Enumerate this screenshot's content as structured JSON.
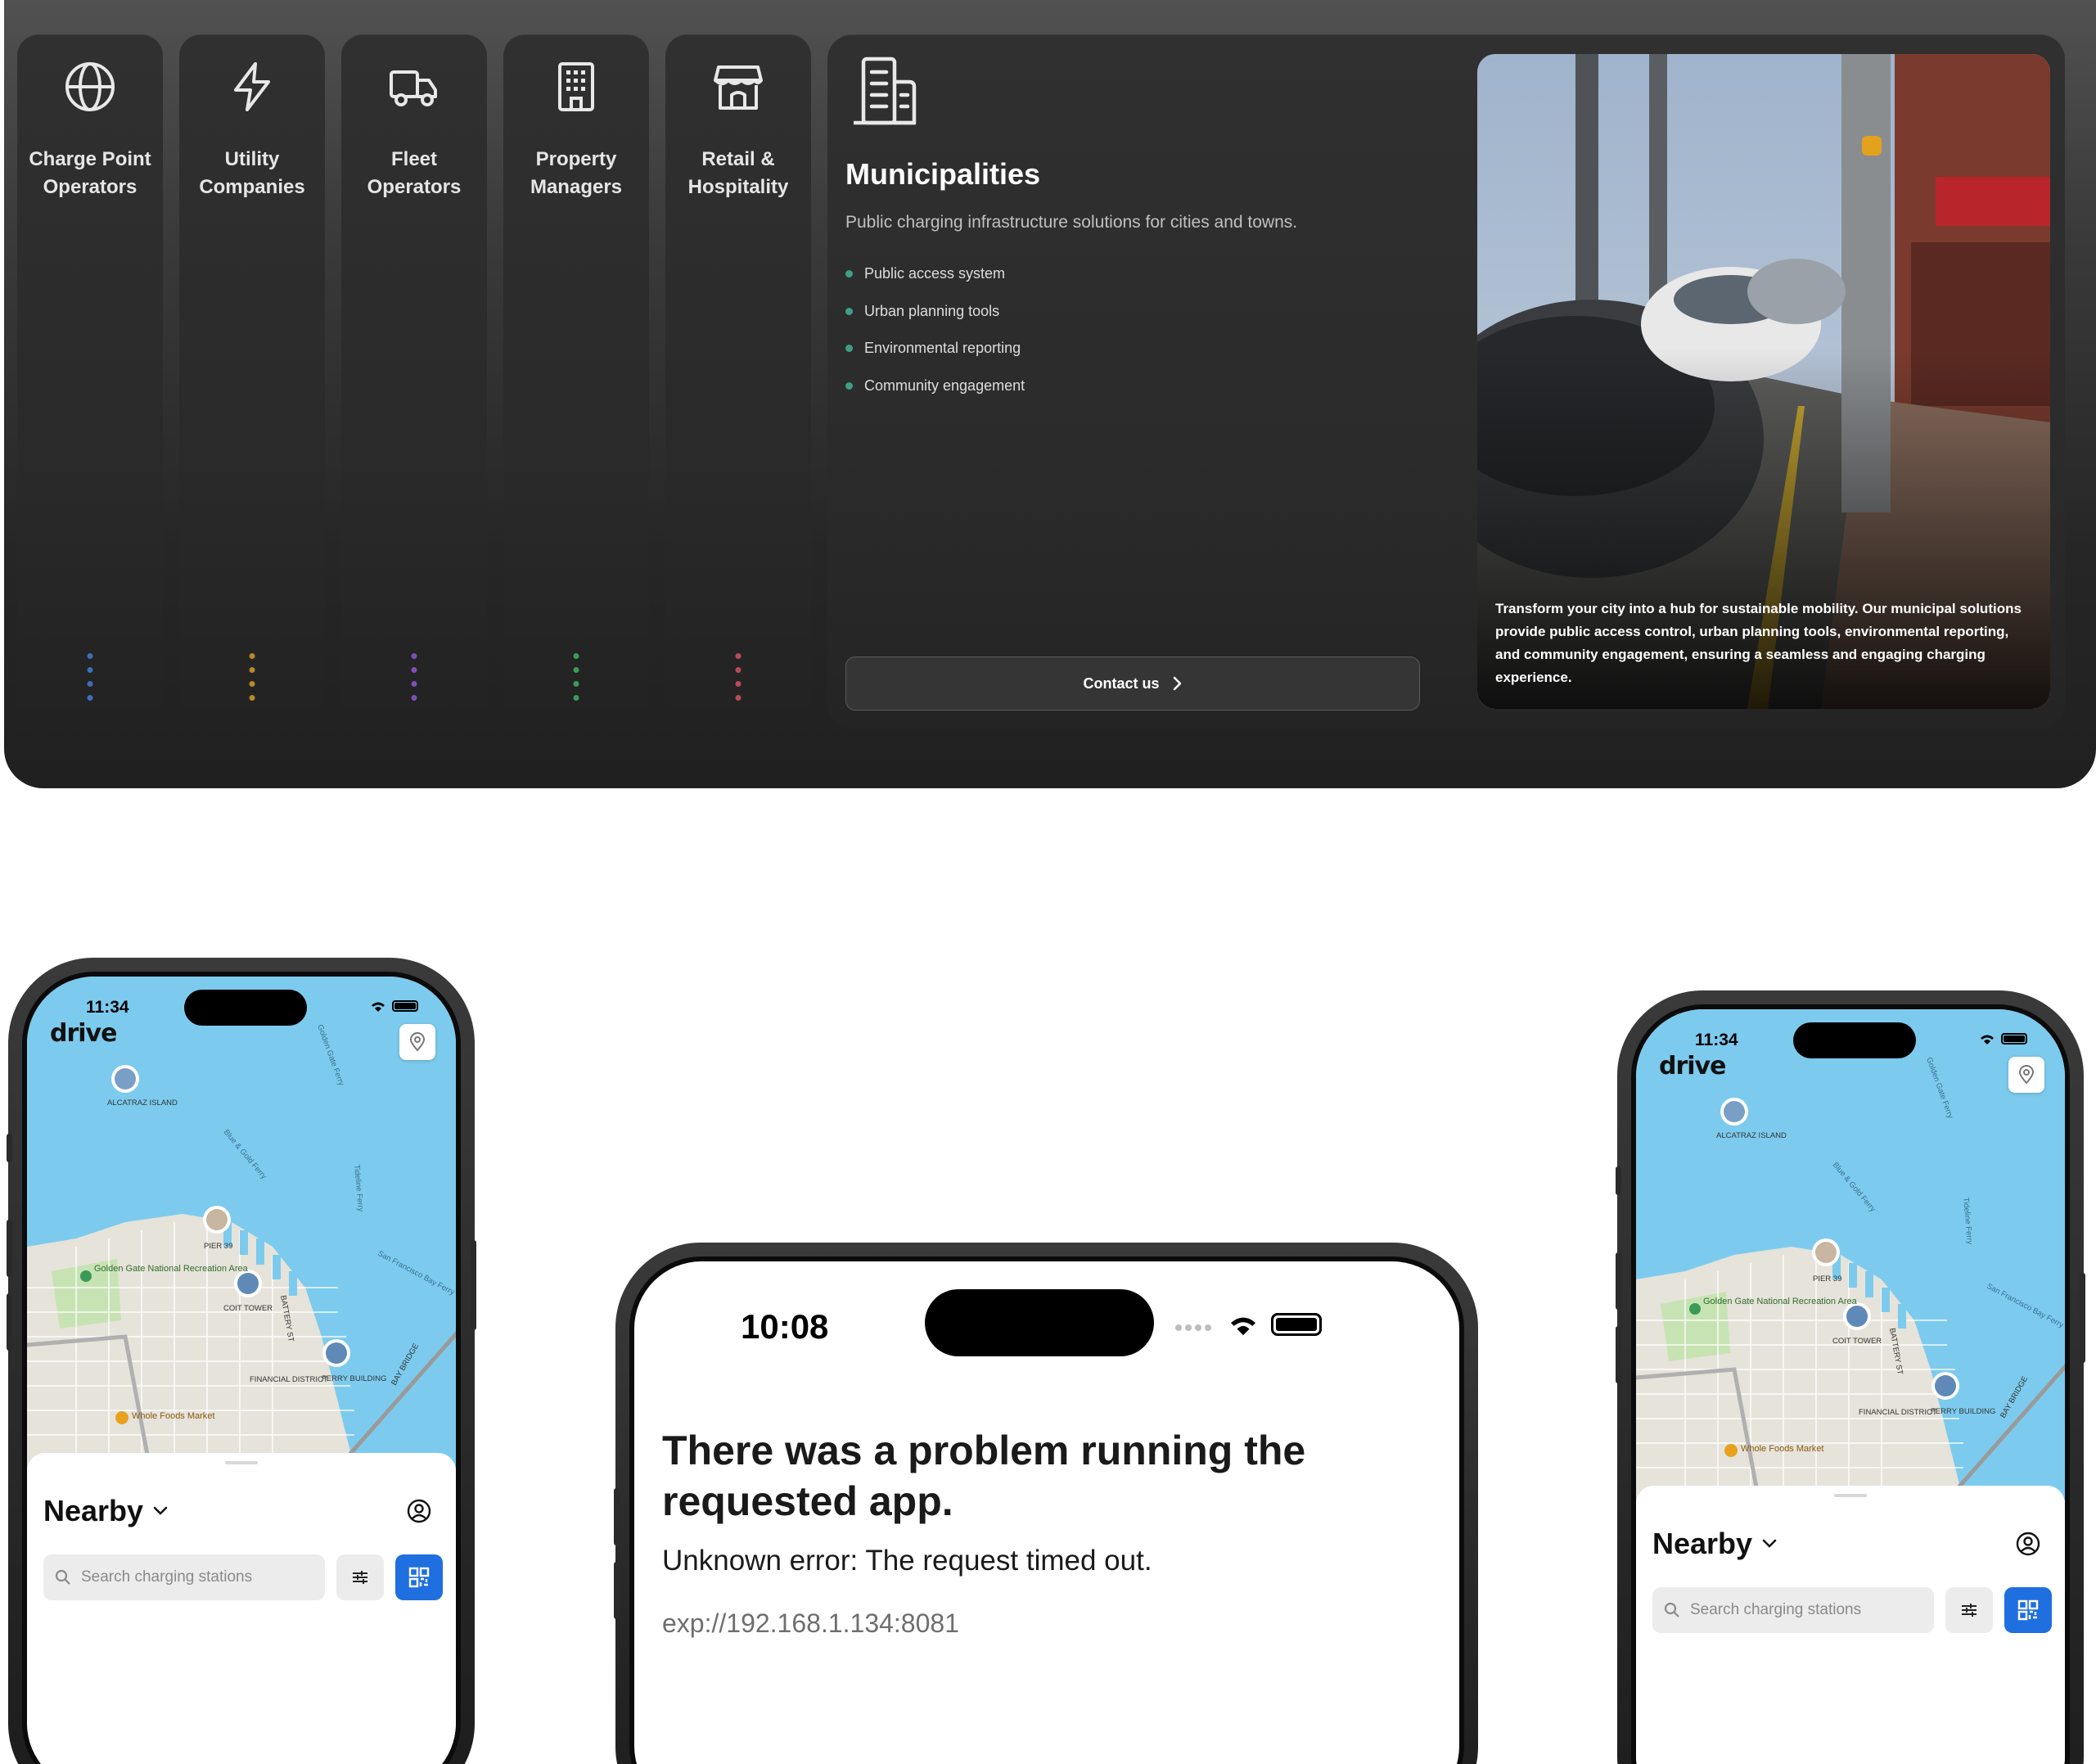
{
  "categories": [
    {
      "label": "Charge Point Operators",
      "icon": "globe-icon",
      "dot_color": "#3d6fb5"
    },
    {
      "label": "Utility Companies",
      "icon": "lightning-icon",
      "dot_color": "#b58a2a"
    },
    {
      "label": "Fleet Operators",
      "icon": "truck-icon",
      "dot_color": "#7e4fb5"
    },
    {
      "label": "Property Managers",
      "icon": "building-icon",
      "dot_color": "#3a9b58"
    },
    {
      "label": "Retail & Hospitality",
      "icon": "storefront-icon",
      "dot_color": "#b84a5a"
    }
  ],
  "detail": {
    "icon": "municipal-building-icon",
    "title": "Municipalities",
    "subtitle": "Public charging infrastructure solutions for cities and towns.",
    "features": [
      "Public access system",
      "Urban planning tools",
      "Environmental reporting",
      "Community engagement"
    ],
    "feature_bullet_color": "#3e9e88",
    "contact_label": "Contact us",
    "photo_caption": "Transform your city into a hub for sustainable mobility. Our municipal solutions provide public access control, urban planning tools, environmental reporting, and community engagement, ensuring a seamless and engaging charging experience."
  },
  "app_phone": {
    "time": "11:34",
    "logo": "drive",
    "map_labels": {
      "alcatraz": "ALCATRAZ ISLAND",
      "pier39": "PIER 39",
      "coit": "COIT TOWER",
      "ferry": "FERRY BUILDING",
      "financial": "FINANCIAL DISTRICT",
      "wholefoods": "Whole Foods Market",
      "goldengate": "Golden Gate National Recreation Area",
      "ggferry": "Golden Gate Ferry",
      "bluegold": "Blue & Gold Ferry",
      "tideline": "Tideline Ferry",
      "sfbay": "San Francisco Bay Ferry",
      "battery": "BATTERY ST",
      "baybridge": "BAY BRIDGE"
    },
    "nearby_label": "Nearby",
    "search_placeholder": "Search charging stations",
    "accent": "#1f6fe0"
  },
  "error_phone": {
    "time": "10:08",
    "title": "There was a problem running the requested app.",
    "message": "Unknown error: The request timed out.",
    "url": "exp://192.168.1.134:8081"
  }
}
